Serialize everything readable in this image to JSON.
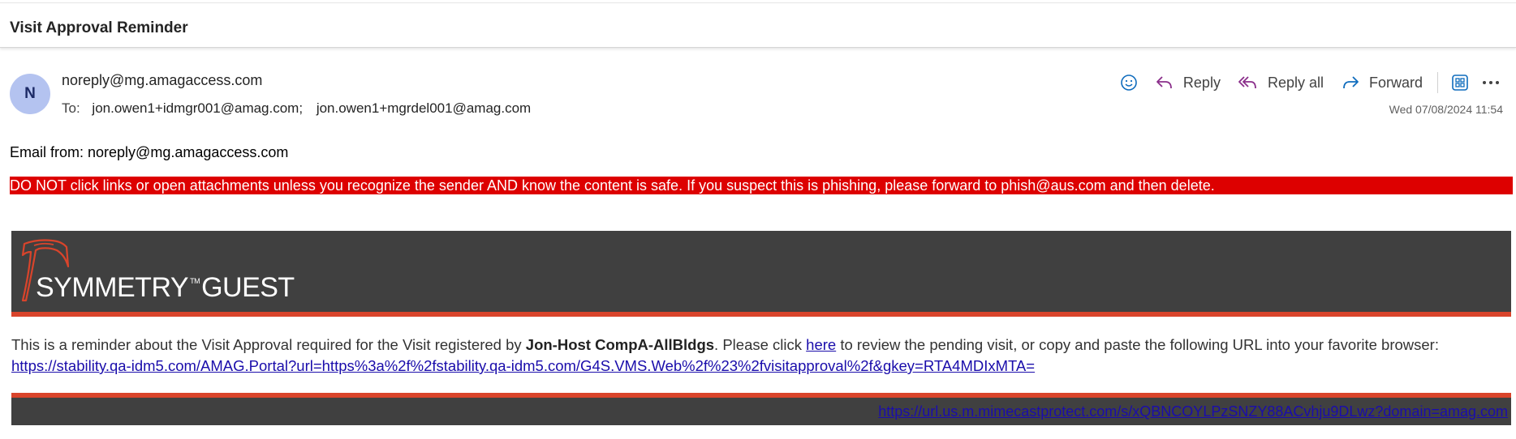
{
  "email": {
    "subject": "Visit Approval Reminder",
    "avatar_initial": "N",
    "sender": "noreply@mg.amagaccess.com",
    "to_label": "To:",
    "recipients": [
      "jon.owen1+idmgr001@amag.com;",
      "jon.owen1+mgrdel001@amag.com"
    ],
    "timestamp": "Wed 07/08/2024 11:54"
  },
  "toolbar": {
    "reply_label": "Reply",
    "reply_all_label": "Reply all",
    "forward_label": "Forward",
    "icons": [
      "emoji-icon",
      "reply-icon",
      "reply-all-icon",
      "forward-icon",
      "apps-icon",
      "more-icon"
    ]
  },
  "message": {
    "from_line": "Email from: noreply@mg.amagaccess.com",
    "warning": "DO NOT click links or open attachments unless you recognize the sender AND know the content is safe. If you suspect this is phishing, please forward to phish@aus.com and then delete.",
    "logo_word_main": "SYMMETRY",
    "logo_tm": "TM",
    "logo_word_guest": "GUEST",
    "body_before_host": "This is a reminder about the Visit Approval required for the Visit registered by ",
    "host_name": "Jon-Host CompA-AllBldgs",
    "body_after_host": ". Please click ",
    "here_link": "here",
    "body_after_link": " to review the pending visit, or copy and paste the following URL into your favorite browser:",
    "portal_url": "https://stability.qa-idm5.com/AMAG.Portal?url=https%3a%2f%2fstability.qa-idm5.com/G4S.VMS.Web%2f%23%2fvisitapproval%2f&gkey=RTA4MDIxMTA=",
    "footer_url": "https://url.us.m.mimecastprotect.com/s/xQBNCOYLPzSNZY88ACvhju9DLwz?domain=amag.com"
  },
  "colors": {
    "warning_bg": "#dd0000",
    "banner_bg": "#404040",
    "banner_accent": "#d9442b",
    "avatar_bg": "#b4c3f0",
    "link": "#1a0dab",
    "toolbar_accent": "#0f6cbd"
  }
}
